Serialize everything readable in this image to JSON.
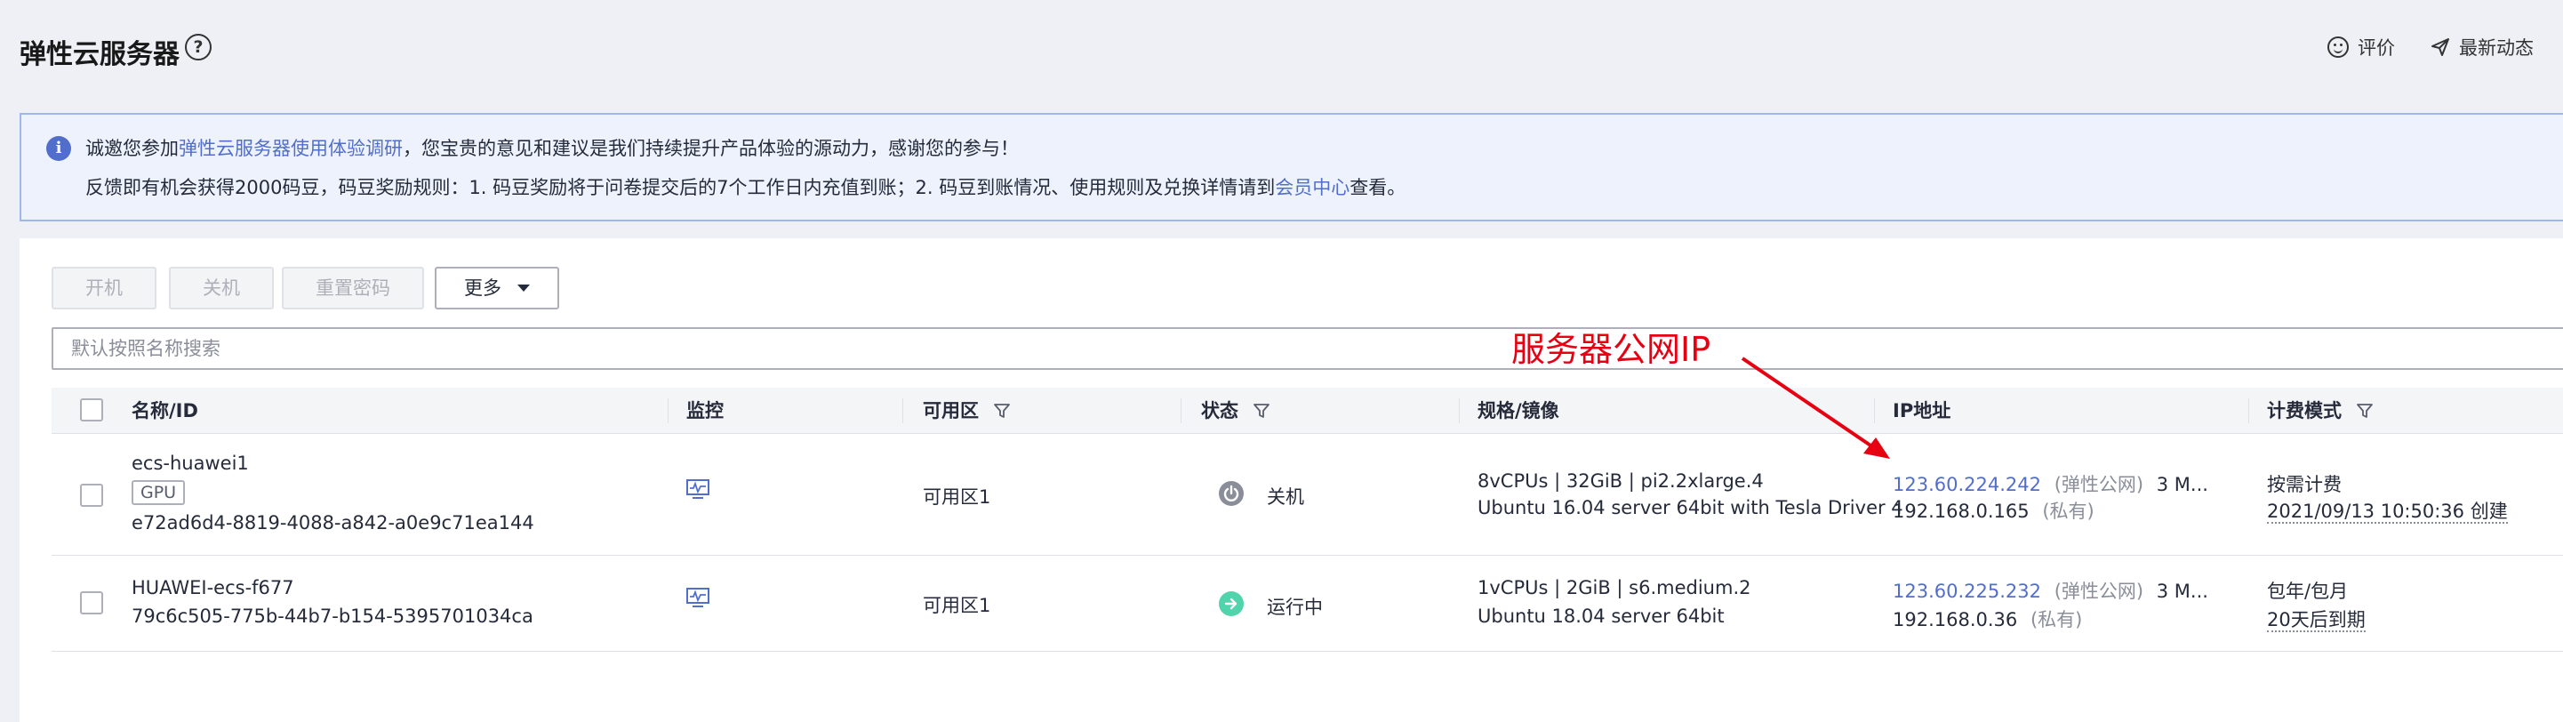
{
  "header": {
    "title": "弹性云服务器",
    "help_icon": "?",
    "review_label": "评价",
    "news_label": "最新动态"
  },
  "notice": {
    "line1_pre": "诚邀您参加",
    "line1_link": "弹性云服务器使用体验调研",
    "line1_post": "，您宝贵的意见和建议是我们持续提升产品体验的源动力，感谢您的参与！",
    "line2_pre": "反馈即有机会获得2000码豆，码豆奖励规则：1. 码豆奖励将于问卷提交后的7个工作日内充值到账；2. 码豆到账情况、使用规则及兑换详情请到",
    "line2_link": "会员中心",
    "line2_post": "查看。",
    "icon": "info-icon"
  },
  "toolbar": {
    "power_on": "开机",
    "power_off": "关机",
    "reset_password": "重置密码",
    "more": "更多"
  },
  "search": {
    "placeholder": "默认按照名称搜索"
  },
  "table": {
    "columns": {
      "name": "名称/ID",
      "monitor": "监控",
      "az": "可用区",
      "status": "状态",
      "spec": "规格/镜像",
      "ip": "IP地址",
      "billing": "计费模式"
    },
    "rows": [
      {
        "name": "ecs-huawei1",
        "tag": "GPU",
        "id": "e72ad6d4-8819-4088-a842-a0e9c71ea144",
        "az": "可用区1",
        "status": "关机",
        "spec": "8vCPUs | 32GiB | pi2.2xlarge.4",
        "image": "Ubuntu 16.04 server 64bit with Tesla Driver 4",
        "public_ip": "123.60.224.242",
        "public_ip_type": "(弹性公网)",
        "bandwidth": "3 M...",
        "private_ip": "192.168.0.165",
        "private_ip_type": "(私有)",
        "billing": "按需计费",
        "billing_detail": "2021/09/13 10:50:36 创建"
      },
      {
        "name": "HUAWEI-ecs-f677",
        "id": "79c6c505-775b-44b7-b154-5395701034ca",
        "az": "可用区1",
        "status": "运行中",
        "spec": "1vCPUs | 2GiB | s6.medium.2",
        "image": "Ubuntu 18.04 server 64bit",
        "public_ip": "123.60.225.232",
        "public_ip_type": "(弹性公网)",
        "bandwidth": "3 M...",
        "private_ip": "192.168.0.36",
        "private_ip_type": "(私有)",
        "billing": "包年/包月",
        "billing_detail": "20天后到期"
      }
    ]
  },
  "annotation": {
    "text": "服务器公网IP"
  },
  "colors": {
    "link": "#526ecc",
    "annotation": "#e60012",
    "status_off": "#8a8e99",
    "status_running": "#50d4ab"
  }
}
